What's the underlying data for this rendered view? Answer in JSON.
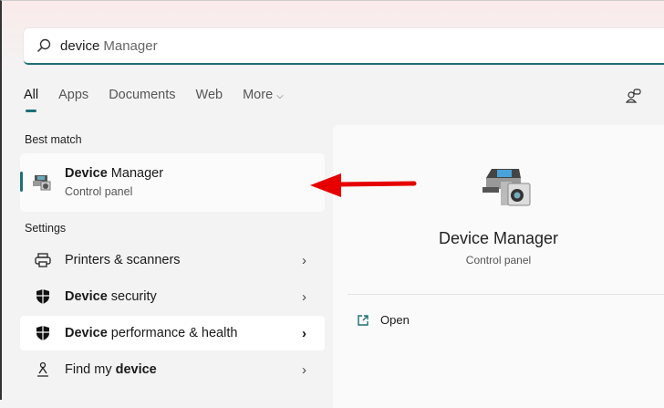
{
  "search": {
    "typed": "device",
    "completion": "Manager"
  },
  "tabs": [
    "All",
    "Apps",
    "Documents",
    "Web",
    "More"
  ],
  "best_match": {
    "label": "Best match",
    "title_bold": "Device",
    "title_rest": "Manager",
    "subtitle": "Control panel"
  },
  "settings": {
    "label": "Settings",
    "items": [
      {
        "pre": "",
        "bold": "",
        "post": "Printers & scanners",
        "icon": "printer-icon"
      },
      {
        "pre": "",
        "bold": "Device",
        "post": " security",
        "icon": "shield-icon"
      },
      {
        "pre": "",
        "bold": "Device",
        "post": " performance & health",
        "icon": "shield-icon"
      },
      {
        "pre": "Find my ",
        "bold": "device",
        "post": "",
        "icon": "person-location-icon"
      }
    ]
  },
  "preview": {
    "title": "Device Manager",
    "subtitle": "Control panel",
    "open_label": "Open"
  },
  "colors": {
    "accent": "#1e6f78",
    "arrow": "#e60000"
  }
}
